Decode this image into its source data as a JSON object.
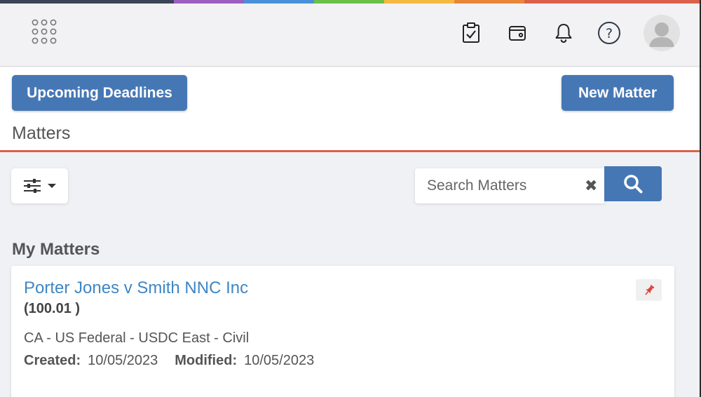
{
  "brand_strip_colors": [
    "#3a4556",
    "#9b5fc0",
    "#4a90d9",
    "#6cc04a",
    "#f5b941",
    "#e8873a",
    "#d9604b"
  ],
  "top_bar": {
    "icons": [
      "app-grid-icon",
      "tasks-clipboard-icon",
      "wallet-icon",
      "bell-icon",
      "help-icon",
      "user-avatar-icon"
    ]
  },
  "header": {
    "upcoming_deadlines_label": "Upcoming Deadlines",
    "new_matter_label": "New Matter",
    "page_title": "Matters"
  },
  "toolbar": {
    "filter_icon": "sliders-icon",
    "search": {
      "placeholder": "Search Matters",
      "value": "",
      "clear_symbol": "✖"
    }
  },
  "my_matters": {
    "title": "My Matters",
    "items": [
      {
        "name": "Porter Jones v Smith NNC Inc",
        "number": "(100.01 )",
        "court": "CA - US Federal - USDC East - Civil",
        "created_label": "Created:",
        "created": "10/05/2023",
        "modified_label": "Modified:",
        "modified": "10/05/2023",
        "pinned": true
      }
    ]
  },
  "colors": {
    "primary": "#4677b5",
    "link": "#3f86c4",
    "accent_border": "#d9604b",
    "pin": "#e0433d"
  }
}
